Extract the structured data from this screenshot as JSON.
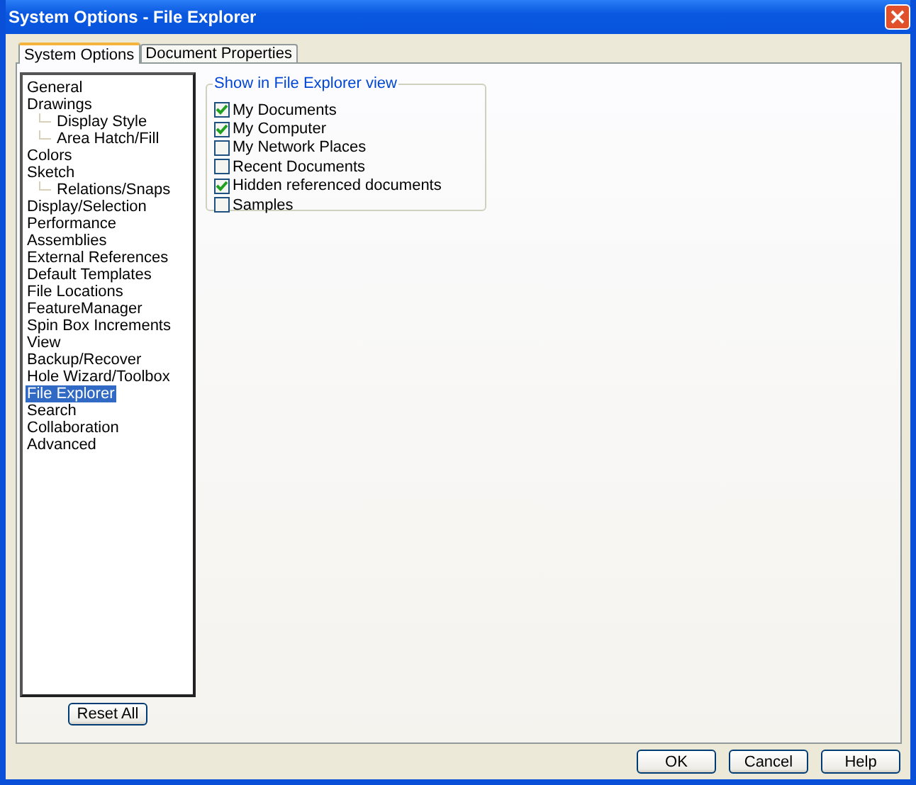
{
  "window": {
    "title": "System Options - File Explorer"
  },
  "tabs": [
    {
      "label": "System Options",
      "selected": true
    },
    {
      "label": "Document Properties",
      "selected": false
    }
  ],
  "tree": {
    "items": [
      {
        "label": "General",
        "selected": false
      },
      {
        "label": "Drawings",
        "selected": false,
        "children": [
          {
            "label": "Display Style",
            "selected": false
          },
          {
            "label": "Area Hatch/Fill",
            "selected": false
          }
        ]
      },
      {
        "label": "Colors",
        "selected": false
      },
      {
        "label": "Sketch",
        "selected": false,
        "children": [
          {
            "label": "Relations/Snaps",
            "selected": false
          }
        ]
      },
      {
        "label": "Display/Selection",
        "selected": false
      },
      {
        "label": "Performance",
        "selected": false
      },
      {
        "label": "Assemblies",
        "selected": false
      },
      {
        "label": "External References",
        "selected": false
      },
      {
        "label": "Default Templates",
        "selected": false
      },
      {
        "label": "File Locations",
        "selected": false
      },
      {
        "label": "FeatureManager",
        "selected": false
      },
      {
        "label": "Spin Box Increments",
        "selected": false
      },
      {
        "label": "View",
        "selected": false
      },
      {
        "label": "Backup/Recover",
        "selected": false
      },
      {
        "label": "Hole Wizard/Toolbox",
        "selected": false
      },
      {
        "label": "File Explorer",
        "selected": true
      },
      {
        "label": "Search",
        "selected": false
      },
      {
        "label": "Collaboration",
        "selected": false
      },
      {
        "label": "Advanced",
        "selected": false
      }
    ]
  },
  "reset_button": "Reset All",
  "group": {
    "title": "Show in File Explorer view",
    "options": [
      {
        "label": "My Documents",
        "checked": true
      },
      {
        "label": "My Computer",
        "checked": true
      },
      {
        "label": "My Network Places",
        "checked": false
      },
      {
        "label": "Recent Documents",
        "checked": false
      },
      {
        "label": "Hidden referenced documents",
        "checked": true
      },
      {
        "label": "Samples",
        "checked": false
      }
    ]
  },
  "buttons": [
    "OK",
    "Cancel",
    "Help"
  ]
}
